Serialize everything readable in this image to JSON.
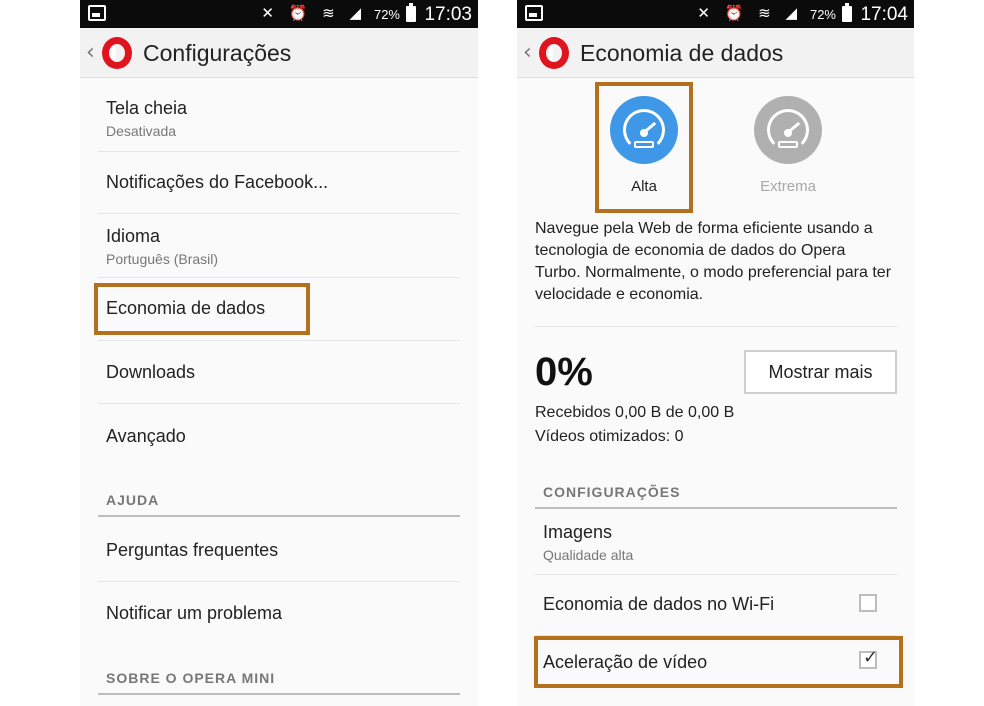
{
  "status_bar": {
    "left": {
      "battery_pct": "72%",
      "time": "17:03"
    },
    "right": {
      "battery_pct": "72%",
      "time": "17:04"
    }
  },
  "left_screen": {
    "title": "Configurações",
    "items": [
      {
        "title": "Tela cheia",
        "subtitle": "Desativada"
      },
      {
        "title": "Notificações do Facebook..."
      },
      {
        "title": "Idioma",
        "subtitle": "Português (Brasil)"
      },
      {
        "title": "Economia de dados"
      },
      {
        "title": "Downloads"
      },
      {
        "title": "Avançado"
      }
    ],
    "section_help": "AJUDA",
    "help_items": [
      {
        "title": "Perguntas frequentes"
      },
      {
        "title": "Notificar um problema"
      }
    ],
    "section_about": "SOBRE O OPERA MINI"
  },
  "right_screen": {
    "title": "Economia de dados",
    "modes": [
      {
        "label": "Alta",
        "icon": "speedometer-icon",
        "color": "#3f97e8",
        "selected": true
      },
      {
        "label": "Extrema",
        "icon": "speedometer-icon",
        "color": "#b0b0b0",
        "selected": false
      }
    ],
    "description": "Navegue pela Web de forma eficiente usando a tecnologia de economia de dados do Opera Turbo. Normalmente, o modo preferencial para ter velocidade e economia.",
    "savings_pct": "0%",
    "more_button": "Mostrar mais",
    "received": "Recebidos 0,00 B de 0,00 B",
    "videos": "Vídeos otimizados: 0",
    "section_config": "CONFIGURAÇÕES",
    "images": {
      "title": "Imagens",
      "subtitle": "Qualidade alta"
    },
    "wifi_saving": {
      "label": "Economia de dados no Wi-Fi",
      "checked": false
    },
    "video_accel": {
      "label": "Aceleração de vídeo",
      "checked": true
    }
  },
  "colors": {
    "highlight": "#b5701d",
    "opera_red": "#e0141e",
    "accent_blue": "#3f97e8"
  }
}
